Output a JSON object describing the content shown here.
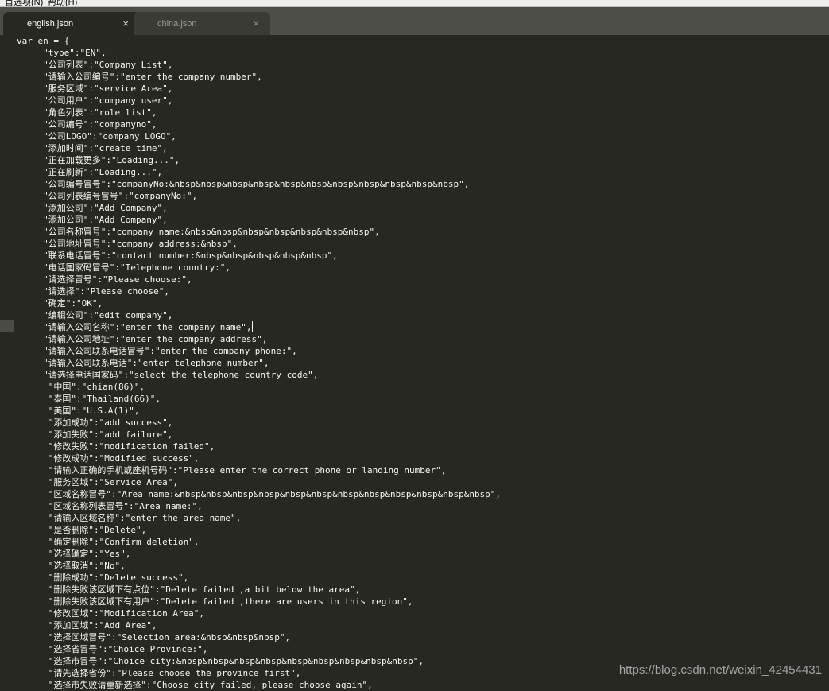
{
  "menubar": {
    "items": [
      "首选项(N)",
      "帮助(H)"
    ]
  },
  "tabs": [
    {
      "label": "english.json",
      "close_icon": "×"
    },
    {
      "label": "china.json",
      "close_icon": "×"
    }
  ],
  "editor": {
    "lines": [
      "var en = {",
      "     \"type\":\"EN\",",
      "     \"公司列表\":\"Company List\",",
      "     \"请输入公司编号\":\"enter the company number\",",
      "     \"服务区域\":\"service Area\",",
      "     \"公司用户\":\"company user\",",
      "     \"角色列表\":\"role list\",",
      "     \"公司编号\":\"companyno\",",
      "     \"公司LOGO\":\"company LOGO\",",
      "     \"添加时间\":\"create time\",",
      "     \"正在加载更多\":\"Loading...\",",
      "     \"正在刷新\":\"Loading...\",",
      "     \"公司编号冒号\":\"companyNo:&nbsp&nbsp&nbsp&nbsp&nbsp&nbsp&nbsp&nbsp&nbsp&nbsp&nbsp\",",
      "     \"公司列表编号冒号\":\"companyNo:\",",
      "     \"添加公司\":\"Add Company\",",
      "     \"添加公司\":\"Add Company\",",
      "     \"公司名称冒号\":\"company name:&nbsp&nbsp&nbsp&nbsp&nbsp&nbsp&nbsp\",",
      "     \"公司地址冒号\":\"company address:&nbsp\",",
      "     \"联系电话冒号\":\"contact number:&nbsp&nbsp&nbsp&nbsp&nbsp\",",
      "     \"电话国家码冒号\":\"Telephone country:\",",
      "     \"请选择冒号\":\"Please choose:\",",
      "     \"请选择\":\"Please choose\",",
      "     \"确定\":\"OK\",",
      "     \"编辑公司\":\"edit company\",",
      "     \"请输入公司名称\":\"enter the company name\",",
      "     \"请输入公司地址\":\"enter the company address\",",
      "     \"请输入公司联系电话冒号\":\"enter the company phone:\",",
      "     \"请输入公司联系电话\":\"enter telephone number\",",
      "     \"请选择电话国家码\":\"select the telephone country code\",",
      "      \"中国\":\"chian(86)\",",
      "      \"泰国\":\"Thailand(66)\",",
      "      \"美国\":\"U.S.A(1)\",",
      "      \"添加成功\":\"add success\",",
      "      \"添加失败\":\"add failure\",",
      "      \"修改失败\":\"modification failed\",",
      "      \"修改成功\":\"Modified success\",",
      "      \"请输入正确的手机或座机号码\":\"Please enter the correct phone or landing number\",",
      "      \"服务区域\":\"Service Area\",",
      "      \"区域名称冒号\":\"Area name:&nbsp&nbsp&nbsp&nbsp&nbsp&nbsp&nbsp&nbsp&nbsp&nbsp&nbsp&nbsp\",",
      "      \"区域名称列表冒号\":\"Area name:\",",
      "      \"请输入区域名称\":\"enter the area name\",",
      "      \"是否删除\":\"Delete\",",
      "      \"确定删除\":\"Confirm deletion\",",
      "      \"选择确定\":\"Yes\",",
      "      \"选择取消\":\"No\",",
      "      \"删除成功\":\"Delete success\",",
      "      \"删除失败该区域下有点位\":\"Delete failed ,a bit below the area\",",
      "      \"删除失败该区域下有用户\":\"Delete failed ,there are users in this region\",",
      "      \"修改区域\":\"Modification Area\",",
      "      \"添加区域\":\"Add Area\",",
      "      \"选择区域冒号\":\"Selection area:&nbsp&nbsp&nbsp\",",
      "      \"选择省冒号\":\"Choice Province:\",",
      "      \"选择市冒号\":\"Choice city:&nbsp&nbsp&nbsp&nbsp&nbsp&nbsp&nbsp&nbsp&nbsp\",",
      "      \"请先选择省份\":\"Please choose the province first\",",
      "      \"选择市失败请重新选择\":\"Choose city failed, please choose again\","
    ]
  },
  "watermark": "https://blog.csdn.net/weixin_42454431"
}
